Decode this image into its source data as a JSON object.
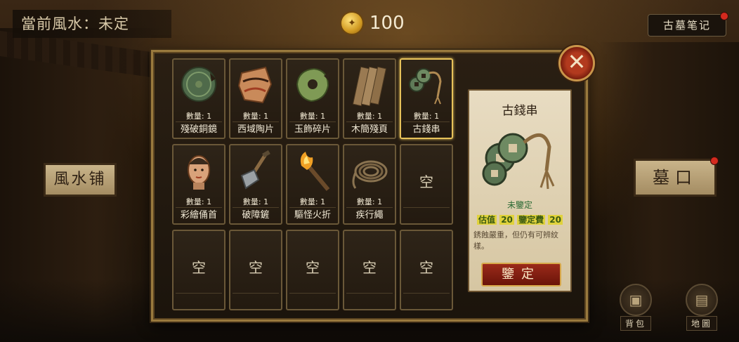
{
  "hud": {
    "fengshui_label": "當前風水：未定",
    "coin_count": "100",
    "notes_button": "古墓笔记"
  },
  "scene": {
    "shop_sign": "風水铺",
    "tomb_sign": "墓口",
    "bag_label": "背包",
    "map_label": "地圖"
  },
  "inventory": {
    "items": [
      {
        "name": "殘破銅鏡",
        "qty": "數量: 1",
        "icon": "bronze-mirror"
      },
      {
        "name": "西域陶片",
        "qty": "數量: 1",
        "icon": "pottery-shard"
      },
      {
        "name": "玉飾碎片",
        "qty": "數量: 1",
        "icon": "jade-fragment"
      },
      {
        "name": "木簡殘頁",
        "qty": "數量: 1",
        "icon": "bamboo-slip"
      },
      {
        "name": "古錢串",
        "qty": "數量: 1",
        "icon": "coin-string",
        "selected": true
      },
      {
        "name": "彩繪俑首",
        "qty": "數量: 1",
        "icon": "figurine-head"
      },
      {
        "name": "破障鏟",
        "qty": "數量: 1",
        "icon": "shovel"
      },
      {
        "name": "驅怪火折",
        "qty": "數量: 1",
        "icon": "torch"
      },
      {
        "name": "疾行繩",
        "qty": "數量: 1",
        "icon": "rope"
      }
    ],
    "empty_label": "空"
  },
  "detail": {
    "title": "古錢串",
    "status": "未鑒定",
    "estimate_label": "估值",
    "estimate_value": "20",
    "fee_label": "鑒定費",
    "fee_value": "20",
    "description": "銹蝕嚴重，但仍有可辨紋樣。",
    "appraise_button": "鑒定"
  },
  "close_icon": "close-icon"
}
